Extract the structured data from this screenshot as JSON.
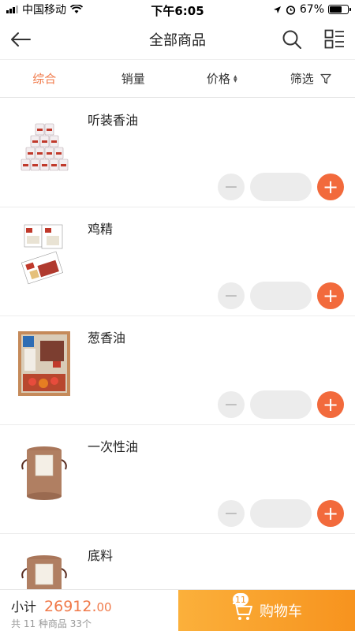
{
  "status_bar": {
    "carrier": "中国移动",
    "time": "下午6:05",
    "battery": "67%",
    "battery_level": 0.67
  },
  "nav": {
    "title": "全部商品",
    "back_icon": "back-arrow-icon",
    "search_icon": "search-icon",
    "layout_icon": "list-layout-icon"
  },
  "sort_bar": {
    "items": [
      {
        "label": "综合",
        "active": true
      },
      {
        "label": "销量",
        "active": false
      },
      {
        "label": "价格",
        "active": false
      },
      {
        "label": "筛选",
        "active": false
      }
    ]
  },
  "products": [
    {
      "name": "听装香油",
      "quantity": "",
      "minus": "−",
      "plus": "+"
    },
    {
      "name": "鸡精",
      "quantity": "",
      "minus": "−",
      "plus": "+"
    },
    {
      "name": "葱香油",
      "quantity": "",
      "minus": "−",
      "plus": "+"
    },
    {
      "name": "一次性油",
      "quantity": "",
      "minus": "−",
      "plus": "+"
    },
    {
      "name": "底料",
      "quantity": "",
      "minus": "−",
      "plus": "+"
    }
  ],
  "bottom_bar": {
    "subtotal_label": "小计",
    "subtotal_amount_int": "26912.",
    "subtotal_amount_dec": "00",
    "summary": "共 11 种商品 33个",
    "cart_badge": "11",
    "cart_label": "购物车"
  },
  "colors": {
    "accent": "#f07a4a",
    "plus_button": "#f26a3c",
    "cart_gradient_start": "#fbb03b",
    "cart_gradient_end": "#f7931e"
  }
}
